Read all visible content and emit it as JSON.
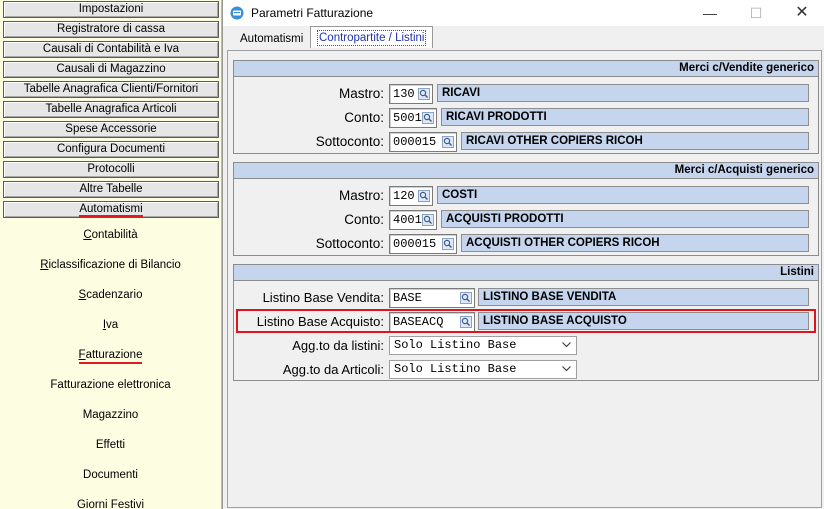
{
  "sidebar": {
    "menu_buttons": [
      {
        "label": "Impostazioni"
      },
      {
        "label": "Registratore di cassa"
      },
      {
        "label": "Causali di Contabilità e Iva"
      },
      {
        "label": "Causali di Magazzino"
      },
      {
        "label": "Tabelle Anagrafica Clienti/Fornitori"
      },
      {
        "label": "Tabelle Anagrafica Articoli"
      },
      {
        "label": "Spese Accessorie"
      },
      {
        "label": "Configura Documenti"
      },
      {
        "label": "Protocolli"
      },
      {
        "label": "Altre Tabelle"
      },
      {
        "label": "Automatismi"
      }
    ],
    "active_menu": "Automatismi",
    "sub_items": [
      {
        "label": "Contabilità"
      },
      {
        "label": "Riclassificazione di Bilancio"
      },
      {
        "label": "Scadenzario"
      },
      {
        "label": "Iva"
      },
      {
        "label": "Fatturazione"
      },
      {
        "label": "Fatturazione elettronica"
      },
      {
        "label": "Magazzino"
      },
      {
        "label": "Effetti"
      },
      {
        "label": "Documenti"
      },
      {
        "label": "Giorni Festivi"
      }
    ],
    "active_sub_item": "Fatturazione"
  },
  "window": {
    "title": "Parametri Fatturazione",
    "controls": {
      "minimize": "—",
      "maximize": "☐",
      "close": "✕"
    },
    "tabs": [
      {
        "label": "Automatismi"
      },
      {
        "label": "Contropartite / Listini"
      }
    ],
    "active_tab": "Contropartite / Listini"
  },
  "sections": {
    "vendite": {
      "title": "Merci c/Vendite generico",
      "mastro": {
        "label": "Mastro:",
        "code": "130",
        "desc": "RICAVI"
      },
      "conto": {
        "label": "Conto:",
        "code": "5001",
        "desc": "RICAVI PRODOTTI"
      },
      "sottoconto": {
        "label": "Sottoconto:",
        "code": "000015",
        "desc": "RICAVI OTHER COPIERS RICOH"
      }
    },
    "acquisti": {
      "title": "Merci c/Acquisti generico",
      "mastro": {
        "label": "Mastro:",
        "code": "120",
        "desc": "COSTI"
      },
      "conto": {
        "label": "Conto:",
        "code": "4001",
        "desc": "ACQUISTI PRODOTTI"
      },
      "sottoconto": {
        "label": "Sottoconto:",
        "code": "000015",
        "desc": "ACQUISTI OTHER COPIERS RICOH"
      }
    },
    "listini": {
      "title": "Listini",
      "base_vendita": {
        "label": "Listino Base Vendita:",
        "code": "BASE",
        "desc": "LISTINO BASE VENDITA"
      },
      "base_acquisto": {
        "label": "Listino Base Acquisto:",
        "code": "BASEACQ",
        "desc": "LISTINO BASE ACQUISTO"
      },
      "agg_listini": {
        "label": "Agg.to da listini:",
        "value": "Solo Listino Base"
      },
      "agg_articoli": {
        "label": "Agg.to da Articoli:",
        "value": "Solo Listino Base"
      }
    }
  },
  "colors": {
    "sidebar_bg": "#fdfde2",
    "desc_field_bg": "#c5d5ee",
    "section_header_bg": "#c5d5ee",
    "highlight": "#e0141d",
    "active_underline": "#e11b22",
    "active_tab_text": "#2233aa"
  },
  "icons": {
    "app": "app-window-icon",
    "lookup": "magnifier-icon",
    "dropdown": "chevron-down-icon"
  }
}
